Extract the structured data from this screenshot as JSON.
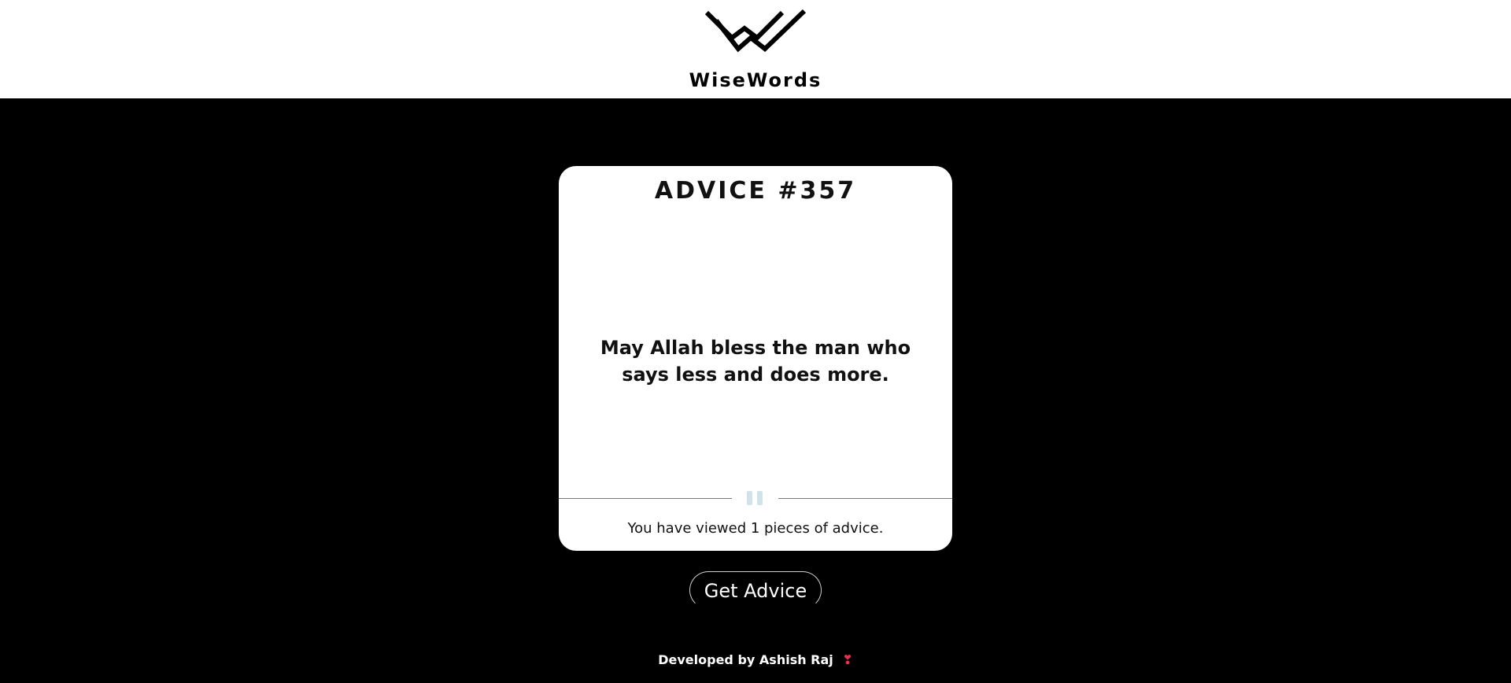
{
  "header": {
    "brand": "WiseWords",
    "logo_icon": "wisewords-w-logo-icon"
  },
  "card": {
    "advice_id": "ADVICE #357",
    "advice_text": "May Allah bless the man who says less and does more.",
    "divider_icon": "pause-icon",
    "viewed_text": "You have viewed 1 pieces of advice."
  },
  "actions": {
    "get_advice_label": "Get Advice"
  },
  "footer": {
    "developed_by": "Developed by Ashish Raj",
    "heart_icon": "heart-icon",
    "heart_glyph": "❣"
  },
  "colors": {
    "background": "#000000",
    "header_bg": "#ffffff",
    "card_bg": "#ffffff",
    "heart": "#e8324f",
    "divider_icon": "#cfe3e8"
  }
}
